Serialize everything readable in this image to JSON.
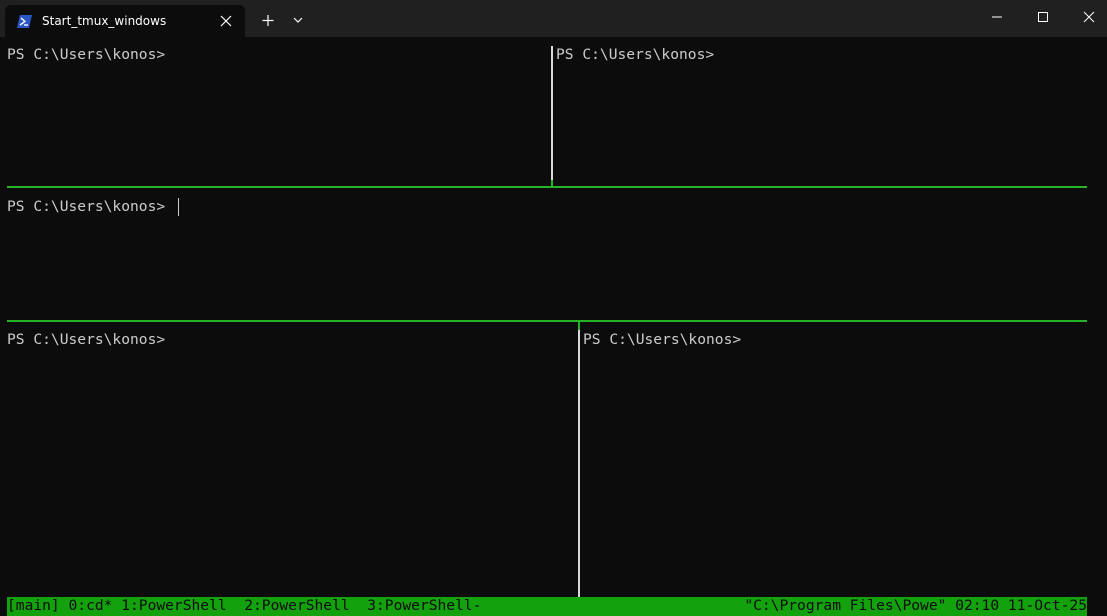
{
  "window": {
    "tab_title": "Start_tmux_windows",
    "tab_icon": "powershell-icon",
    "new_tab_icon": "plus-icon",
    "dropdown_icon": "chevron-down-icon",
    "minimize_icon": "minimize-icon",
    "maximize_icon": "maximize-icon",
    "close_icon": "close-icon"
  },
  "panes": [
    {
      "prompt": "PS C:\\Users\\konos>"
    },
    {
      "prompt": "PS C:\\Users\\konos>"
    },
    {
      "prompt": "PS C:\\Users\\konos> "
    },
    {
      "prompt": "PS C:\\Users\\konos>"
    },
    {
      "prompt": "PS C:\\Users\\konos>"
    }
  ],
  "statusbar": {
    "left": "[main] 0:cd* 1:PowerShell  2:PowerShell  3:PowerShell-",
    "right": "\"C:\\Program Files\\Powe\" 02:10 11-Oct-25"
  },
  "colors": {
    "background": "#0c0c0c",
    "active_border": "#27b327",
    "inactive_border": "#d9d9d9",
    "statusbar": "#13a10e",
    "text": "#cccccc"
  }
}
